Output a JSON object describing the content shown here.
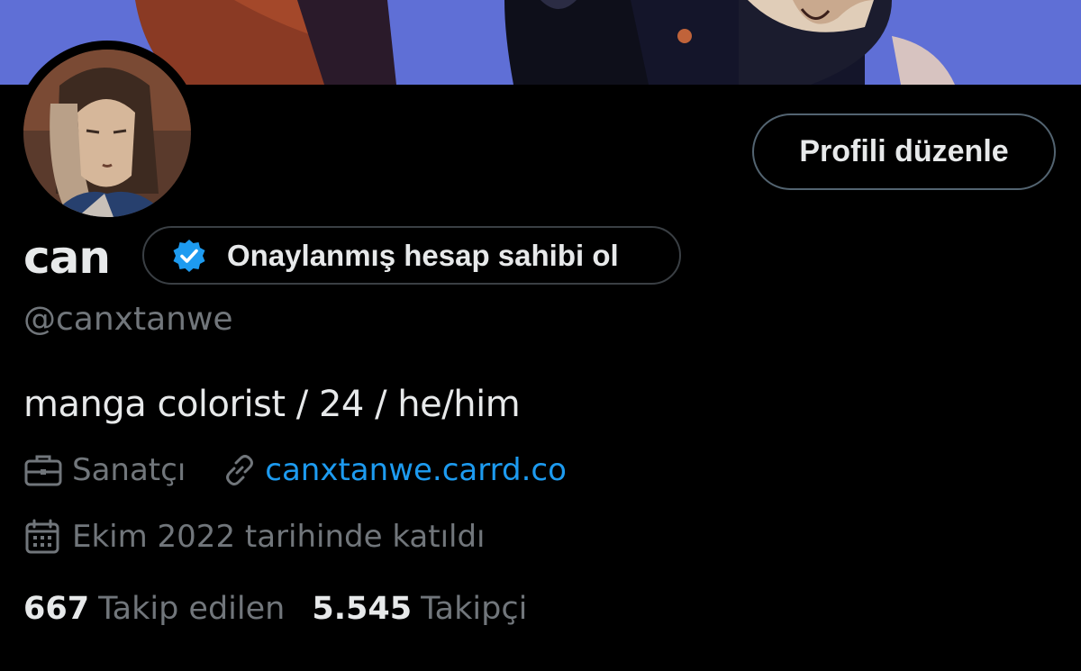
{
  "profile": {
    "display_name": "can",
    "handle": "@canxtanwe",
    "bio": "manga colorist / 24 / he/him",
    "edit_button": "Profili düzenle",
    "verify_cta": "Onaylanmış hesap sahibi ol",
    "profession": "Sanatçı",
    "website": "canxtanwe.carrd.co",
    "joined": "Ekim 2022 tarihinde katıldı",
    "following_count": "667",
    "following_label": "Takip edilen",
    "followers_count": "5.545",
    "followers_label": "Takipçi"
  },
  "icons": {
    "verified": "verified-badge-icon",
    "profession": "briefcase-icon",
    "website": "link-icon",
    "joined": "calendar-icon"
  },
  "colors": {
    "background": "#000000",
    "text_primary": "#e7e9ea",
    "text_secondary": "#71767b",
    "accent": "#1d9bf0",
    "border": "#536471"
  }
}
